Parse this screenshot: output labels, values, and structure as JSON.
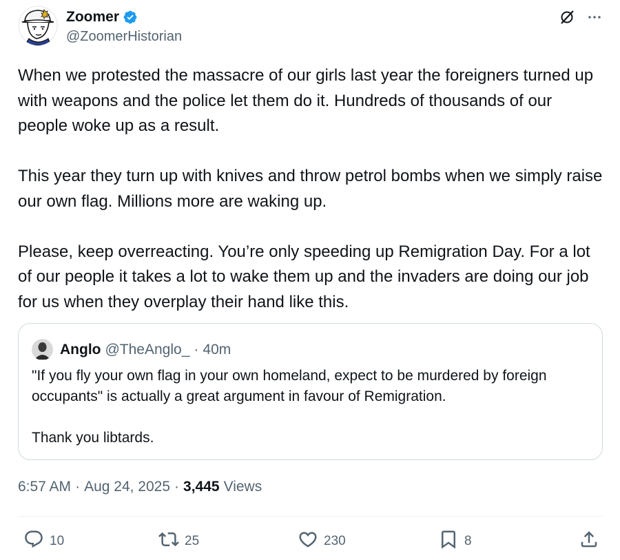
{
  "author": {
    "display_name": "Zoomer",
    "handle": "@ZoomerHistorian",
    "verified_icon": "verified-badge-icon",
    "verified_color": "#1d9bf0"
  },
  "header_actions": {
    "grok_icon": "grok-icon",
    "more_icon": "more-icon"
  },
  "tweet": {
    "paragraphs": [
      "When we protested the massacre of our girls last year the foreigners turned up with weapons and the police let them do it. Hundreds of thousands of our people woke up as a result.",
      "This year they turn up with knives and throw petrol bombs when we simply raise our own flag. Millions more are waking up.",
      "Please, keep overreacting. You’re only speeding up Remigration Day. For a lot of our people it takes a lot to wake them up and the invaders are doing our job for us when they overplay their hand like this."
    ]
  },
  "quote": {
    "name": "Anglo",
    "handle": "@TheAnglo_",
    "separator": "·",
    "time": "40m",
    "paragraphs": [
      "\"If you fly your own flag in your own homeland, expect to be murdered by foreign occupants\" is actually a great argument in favour of Remigration.",
      "Thank you libtards."
    ]
  },
  "meta": {
    "time": "6:57 AM",
    "sep1": "·",
    "date": "Aug 24, 2025",
    "sep2": "·",
    "views_count": "3,445",
    "views_label": "Views"
  },
  "actions": {
    "replies": "10",
    "reposts": "25",
    "likes": "230",
    "bookmarks": "8",
    "icons": [
      "reply-icon",
      "repost-icon",
      "like-icon",
      "bookmark-icon",
      "share-icon"
    ],
    "color": "#536471"
  }
}
